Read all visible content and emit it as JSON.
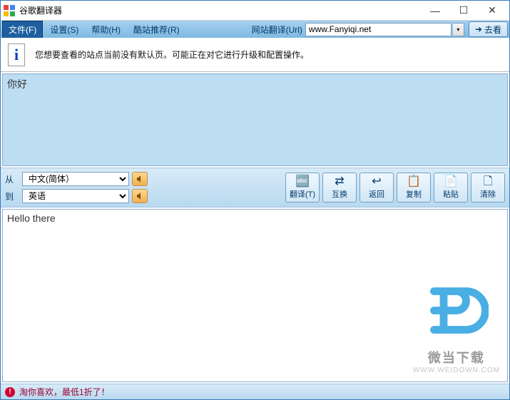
{
  "window": {
    "title": "谷歌翻译器"
  },
  "menu": {
    "file": "文件(F)",
    "settings": "设置(S)",
    "help": "帮助(H)",
    "recommend": "酷站推荐(R)",
    "url_label": "网站翻译(Url)",
    "url_value": "www.Fanyiqi.net",
    "go": "去看"
  },
  "info": {
    "message": "您想要查看的站点当前没有默认页。可能正在对它进行升级和配置操作。"
  },
  "input": {
    "text": "你好"
  },
  "lang": {
    "from_label": "从",
    "from_value": "中文(简体）",
    "to_label": "到",
    "to_value": "英语"
  },
  "actions": {
    "translate": "翻译(T)",
    "swap": "互换",
    "back": "返回",
    "copy": "复制",
    "paste": "粘贴",
    "clear": "清除"
  },
  "output": {
    "text": "Hello there"
  },
  "watermark": {
    "line1": "微当下载",
    "line2": "WWW.WEIDOWN.COM"
  },
  "status": {
    "text": "淘你喜欢，最低1折了！"
  }
}
